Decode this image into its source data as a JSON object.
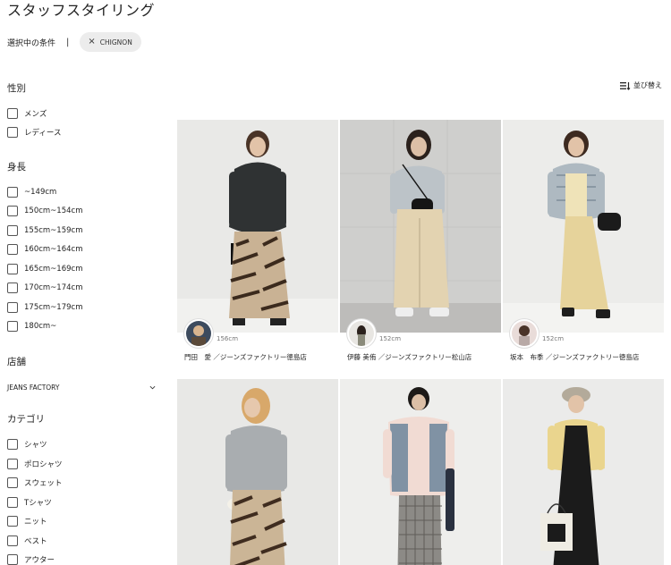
{
  "page": {
    "title": "スタッフスタイリング"
  },
  "conditions": {
    "label": "選択中の条件",
    "chips": [
      "CHIGNON"
    ]
  },
  "sort": {
    "label": "並び替え"
  },
  "filters": {
    "gender": {
      "title": "性別",
      "options": [
        "メンズ",
        "レディース"
      ]
    },
    "height": {
      "title": "身長",
      "options": [
        "~149cm",
        "150cm~154cm",
        "155cm~159cm",
        "160cm~164cm",
        "165cm~169cm",
        "170cm~174cm",
        "175cm~179cm",
        "180cm~"
      ]
    },
    "store": {
      "title": "店舗",
      "selected": "JEANS FACTORY"
    },
    "category": {
      "title": "カテゴリ",
      "options": [
        "シャツ",
        "ポロシャツ",
        "スウェット",
        "Tシャツ",
        "ニット",
        "ベスト",
        "アウター"
      ]
    }
  },
  "cards": [
    {
      "height": "156cm",
      "staff": "門田　愛 ／ジーンズファクトリー徳島店"
    },
    {
      "height": "152cm",
      "staff": "伊藤 美侑 ／ジーンズファクトリー松山店"
    },
    {
      "height": "152cm",
      "staff": "坂本　布季 ／ジーンズファクトリー徳島店"
    },
    {
      "height": "",
      "staff": ""
    },
    {
      "height": "",
      "staff": ""
    },
    {
      "height": "",
      "staff": ""
    }
  ]
}
